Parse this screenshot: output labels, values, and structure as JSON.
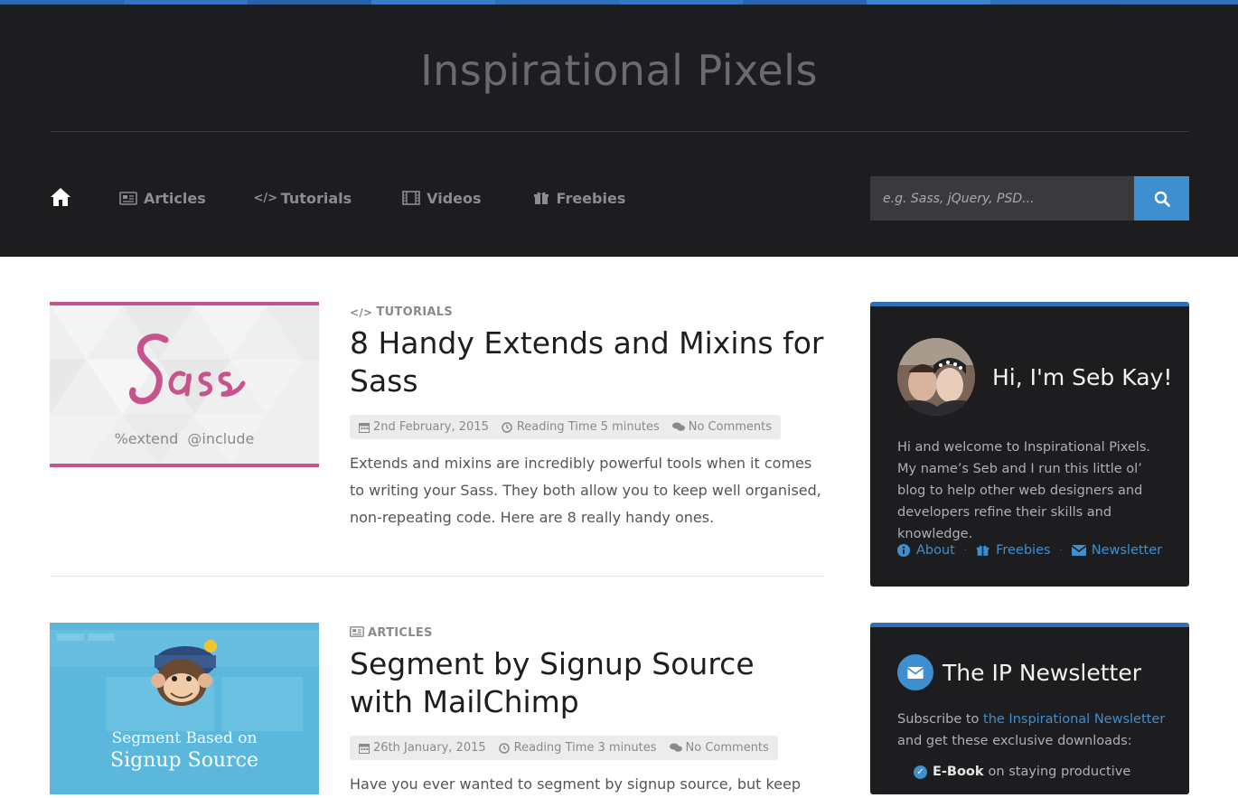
{
  "site": {
    "logo": "Inspirational Pixels",
    "accent": "#3d8fd0",
    "header_bg": "#1d1d1f"
  },
  "nav": {
    "home_icon": "home-icon",
    "items": [
      {
        "label": "Articles",
        "icon": "newspaper-icon"
      },
      {
        "label": "Tutorials",
        "icon": "code-icon"
      },
      {
        "label": "Videos",
        "icon": "film-icon"
      },
      {
        "label": "Freebies",
        "icon": "gift-icon"
      }
    ]
  },
  "search": {
    "placeholder": "e.g. Sass, jQuery, PSD...",
    "button_icon": "search-icon"
  },
  "posts": [
    {
      "category": "TUTORIALS",
      "category_icon": "code-icon",
      "title": "8 Handy Extends and Mixins for Sass",
      "date": "2nd February, 2015",
      "reading_time": "Reading Time 5 minutes",
      "comments": "No Comments",
      "excerpt": "Extends and mixins are incredibly powerful tools when it comes to writing your Sass. They both allow you to keep well organised, non-repeating code. Here are 8 really handy ones.",
      "thumb": {
        "logo": "Sass",
        "caption": "%extend  @include",
        "color": "#c6538c"
      }
    },
    {
      "category": "ARTICLES",
      "category_icon": "newspaper-icon",
      "title": "Segment by Signup Source with MailChimp",
      "date": "26th January, 2015",
      "reading_time": "Reading Time 3 minutes",
      "comments": "No Comments",
      "excerpt": "Have you ever wanted to segment by signup source, but keep",
      "thumb": {
        "line1": "Segment Based on",
        "line2": "Signup Source",
        "color": "#5bb8dc"
      }
    }
  ],
  "sidebar": {
    "about": {
      "title": "Hi, I'm Seb Kay!",
      "text": "Hi and welcome to Inspirational Pixels. My name’s Seb and I run this little ol’ blog to help other web designers and developers refine their skills and knowledge.",
      "links": [
        {
          "label": "About",
          "icon": "info-icon"
        },
        {
          "label": "Freebies",
          "icon": "gift-icon"
        },
        {
          "label": "Newsletter",
          "icon": "envelope-icon"
        }
      ]
    },
    "newsletter": {
      "title": "The IP Newsletter",
      "text_before": "Subscribe to ",
      "link": "the Inspirational Newsletter",
      "text_after": " and get these exclusive downloads:",
      "items": [
        {
          "bold": "E-Book",
          "rest": "on staying productive"
        }
      ]
    }
  }
}
